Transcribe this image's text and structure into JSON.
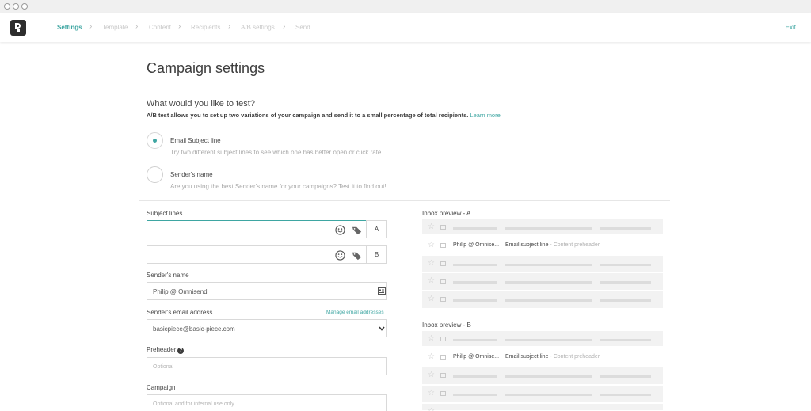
{
  "nav": {
    "steps": [
      "Settings",
      "Template",
      "Content",
      "Recipients",
      "A/B settings",
      "Send"
    ],
    "exit": "Exit"
  },
  "page": {
    "title": "Campaign settings",
    "question": "What would you like to test?",
    "description": "A/B test allows you to set up two variations of your campaign and send it to a small percentage of total recipients.",
    "learn_more": "Learn more"
  },
  "options": [
    {
      "title": "Email Subject line",
      "subtitle": "Try two different subject lines to see which one has better open or click rate.",
      "selected": true
    },
    {
      "title": "Sender's name",
      "subtitle": "Are you using the best Sender's name for your campaigns? Test it to find out!",
      "selected": false
    }
  ],
  "form": {
    "subject_lines_label": "Subject lines",
    "variant_a": "A",
    "variant_b": "B",
    "sender_name_label": "Sender's name",
    "sender_name_value": "Philip @ Omnisend",
    "sender_email_label": "Sender's email address",
    "manage_emails": "Manage email addresses",
    "sender_email_value": "basicpiece@basic-piece.com",
    "preheader_label": "Preheader",
    "preheader_placeholder": "Optional",
    "campaign_label": "Campaign",
    "campaign_placeholder": "Optional and for internal use only"
  },
  "preview": {
    "a_label": "Inbox preview - A",
    "b_label": "Inbox preview - B",
    "from": "Philip @ Omnise...",
    "subject": "Email subject line",
    "preheader": "- Content preheader"
  },
  "colors": {
    "accent": "#3ea6a2",
    "text": "#3d3d3d",
    "muted": "#a9a9a9"
  }
}
